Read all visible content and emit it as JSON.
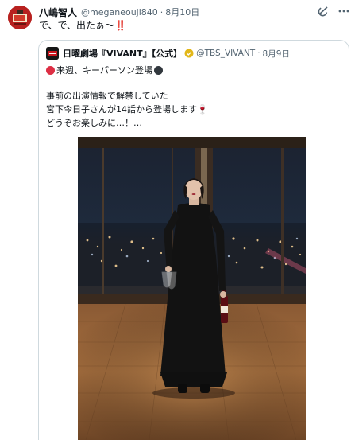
{
  "tweet": {
    "author_name": "八嶋智人",
    "author_handle": "@meganeouji840",
    "separator": "·",
    "date": "8月10日",
    "text": "で、で、出たぁ～",
    "text_emphasis": "‼️"
  },
  "quote": {
    "author_name": "日曜劇場『VIVANT』【公式】",
    "author_handle": "@TBS_VIVANT",
    "separator": "·",
    "date": "8月9日",
    "line1": "来週、キーパーソン登場",
    "line2": "事前の出演情報で解禁していた",
    "line3": "宮下今日子さんが14話から登場します🍷",
    "line4": "どうぞお楽しみに…！…"
  },
  "icons": {
    "grok": "grok-icon",
    "more": "more-icon",
    "verified": "verified-badge-icon",
    "red_circle": "red-circle-icon",
    "black_circle": "black-circle-icon"
  },
  "colors": {
    "text_primary": "#0f1419",
    "text_secondary": "#536471",
    "border": "#cfd9de",
    "avatar_red": "#b0201f",
    "badge_gold": "#e2b719"
  }
}
